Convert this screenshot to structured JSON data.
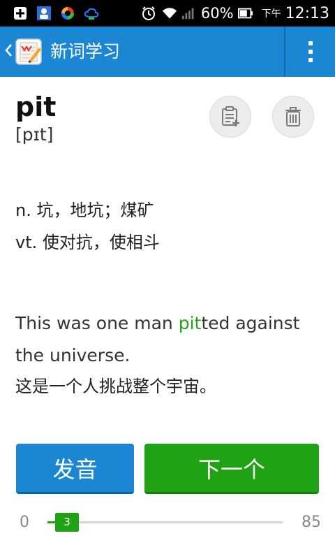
{
  "status_bar": {
    "battery_percent": "60%",
    "am_pm": "下午",
    "time": "12:13",
    "icons": [
      "notification-add-icon",
      "contact-card-icon",
      "sync-app-icon",
      "cloud-icon",
      "alarm-icon",
      "wifi-icon",
      "signal-icon",
      "battery-icon"
    ]
  },
  "action_bar": {
    "title": "新词学习",
    "back_icon": "chevron-left-icon",
    "logo": "word-notebook-logo",
    "menu_icon": "overflow-menu-icon",
    "color": "#1b86d3"
  },
  "word": {
    "headword": "pit",
    "phonetic": "[pɪt]",
    "actions": [
      {
        "name": "add-note",
        "icon": "note-add-icon"
      },
      {
        "name": "delete",
        "icon": "trash-icon"
      }
    ]
  },
  "definitions": [
    "n. 坑，地坑；煤矿",
    "vt. 使对抗，使相斗"
  ],
  "example": {
    "before": "This was one man ",
    "highlight": "pit",
    "after": "ted against the universe.",
    "highlight_color": "#27a31a",
    "translation": "这是一个人挑战整个宇宙。"
  },
  "buttons": {
    "pronounce": "发音",
    "next": "下一个",
    "pronounce_color": "#1b86d3",
    "next_color": "#1fa315"
  },
  "progress": {
    "min": "0",
    "max": "85",
    "current": "3",
    "value": 3
  }
}
